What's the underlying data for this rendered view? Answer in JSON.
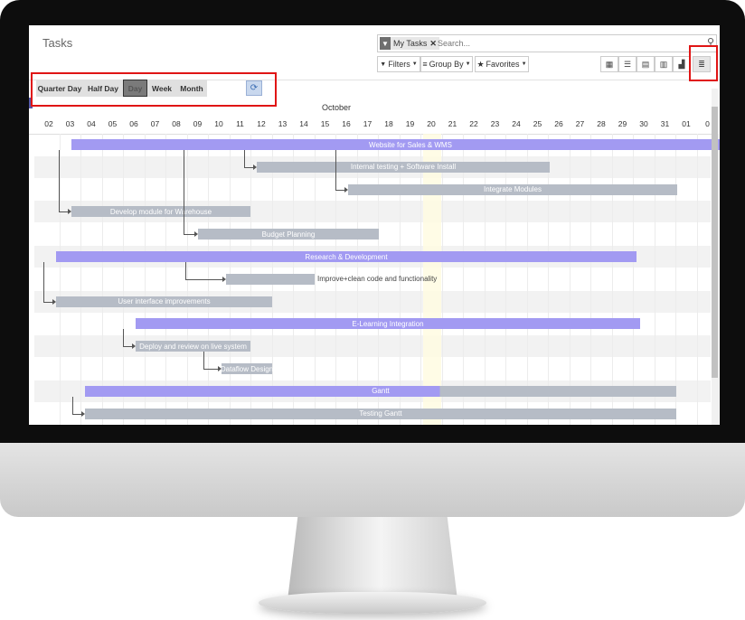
{
  "app": {
    "title": "Tasks"
  },
  "search": {
    "facet_label": "My Tasks",
    "placeholder": "Search...",
    "facet_icon": "filter-icon",
    "button_icon": "search-icon"
  },
  "filters": {
    "filters_label": "Filters",
    "group_by_label": "Group By",
    "favorites_label": "Favorites"
  },
  "views": [
    "kanban-view-icon",
    "list-view-icon",
    "calendar-view-icon",
    "pivot-view-icon",
    "graph-view-icon",
    "gantt-view-icon"
  ],
  "scales": {
    "quarter_day": "Quarter Day",
    "half_day": "Half Day",
    "day": "Day",
    "week": "Week",
    "month": "Month",
    "active": "Day"
  },
  "timeline": {
    "month": "October",
    "days": [
      "02",
      "03",
      "04",
      "05",
      "06",
      "07",
      "08",
      "09",
      "10",
      "11",
      "12",
      "13",
      "14",
      "15",
      "16",
      "17",
      "18",
      "19",
      "20",
      "21",
      "22",
      "23",
      "24",
      "25",
      "26",
      "27",
      "28",
      "29",
      "30",
      "31",
      "01",
      "0"
    ]
  },
  "tasks": [
    {
      "name": "Website for Sales & WMS",
      "parent": true
    },
    {
      "name": "Internal testing + Software Install"
    },
    {
      "name": "Integrate Modules"
    },
    {
      "name": "Develop module for Warehouse"
    },
    {
      "name": "Budget Planning"
    },
    {
      "name": "Research & Development",
      "parent": true
    },
    {
      "name": "Improve+clean code and functionality"
    },
    {
      "name": "User interface improvements"
    },
    {
      "name": "E-Learning Integration",
      "parent": true
    },
    {
      "name": "Deploy and review on live system"
    },
    {
      "name": "Dataflow Design"
    },
    {
      "name": "Gantt",
      "parent": true,
      "progress": 0.6
    },
    {
      "name": "Testing Gantt"
    }
  ],
  "colors": {
    "parent_bar": "#a29af2",
    "child_bar": "#b6bcc6",
    "highlight": "#e01515",
    "today": "#fffbe0"
  }
}
